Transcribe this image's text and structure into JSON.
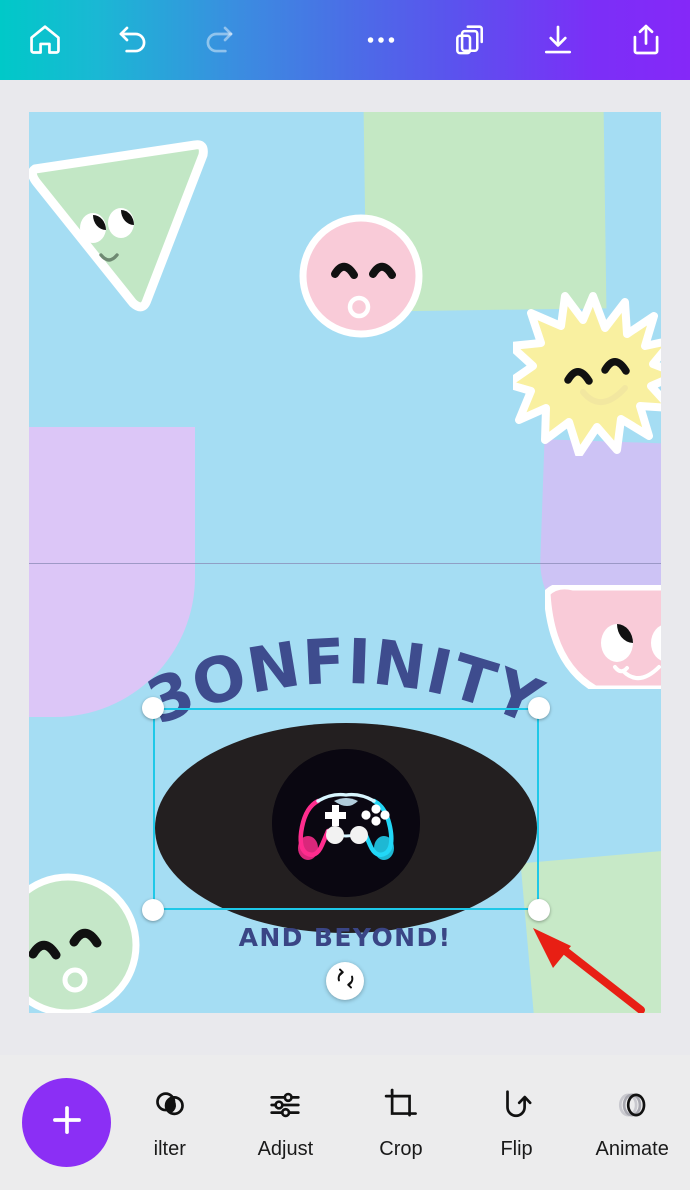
{
  "app": {
    "name": "Canva Editor",
    "background": "#e9e9ed"
  },
  "topbar": {
    "gradient_from": "#00c9c8",
    "gradient_to": "#8528f8",
    "items": [
      {
        "name": "home",
        "icon": "home-icon",
        "label": "Home"
      },
      {
        "name": "undo",
        "icon": "undo-icon",
        "label": "Undo"
      },
      {
        "name": "redo",
        "icon": "redo-icon",
        "label": "Redo",
        "disabled": true
      },
      {
        "name": "more",
        "icon": "more-horizontal-icon",
        "label": "More"
      },
      {
        "name": "layers",
        "icon": "layers-icon",
        "label": "Layers"
      },
      {
        "name": "download",
        "icon": "download-icon",
        "label": "Download"
      },
      {
        "name": "share",
        "icon": "share-icon",
        "label": "Share"
      }
    ]
  },
  "canvas": {
    "background_color": "#a5ddf3",
    "headline": "3ONFINITY",
    "headline_color": "#3e4c8e",
    "subline": "AND BEYOND!",
    "subline_color": "#3a4585",
    "guide_line_color": "#8a8ab5",
    "shapes": [
      {
        "name": "green-triangle-face",
        "color": "#c2e7c5",
        "outline": "#ffffff"
      },
      {
        "name": "pink-circle-face",
        "color": "#f9cbd8",
        "outline": "#ffffff"
      },
      {
        "name": "sun-face",
        "color": "#f9f0a0",
        "outline": "#ffffff"
      },
      {
        "name": "green-rectangle",
        "color": "#c4e8c4"
      },
      {
        "name": "lavender-blob-left",
        "color": "#dcc6f7"
      },
      {
        "name": "lavender-block-right",
        "color": "#cdc3f5"
      },
      {
        "name": "pink-half-face",
        "color": "#f9cbd8",
        "outline": "#ffffff"
      },
      {
        "name": "green-circle-face",
        "color": "#c5e7c8",
        "outline": "#ffffff"
      },
      {
        "name": "green-rectangle-2",
        "color": "#c7e9c7"
      }
    ],
    "selected_element": {
      "name": "game-controller-image",
      "shape": "ellipse",
      "fill": "#231f20",
      "selection_color": "#1ec8e8",
      "handles": [
        "top-left",
        "top-right",
        "bottom-left",
        "bottom-right"
      ],
      "rotate_handle_icon": "rotate-icon"
    },
    "annotation": {
      "name": "red-pointer-arrow",
      "color": "#e81f14"
    }
  },
  "bottombar": {
    "background": "#ececed",
    "fab": {
      "label": "+",
      "color": "#8b2ff5",
      "icon": "plus-icon"
    },
    "tools": [
      {
        "label": "ilter",
        "full_label": "Filter",
        "icon": "filter-circles-icon"
      },
      {
        "label": "Adjust",
        "full_label": "Adjust",
        "icon": "sliders-icon"
      },
      {
        "label": "Crop",
        "full_label": "Crop",
        "icon": "crop-icon"
      },
      {
        "label": "Flip",
        "full_label": "Flip",
        "icon": "flip-icon"
      },
      {
        "label": "Animate",
        "full_label": "Animate",
        "icon": "animate-icon"
      }
    ]
  }
}
